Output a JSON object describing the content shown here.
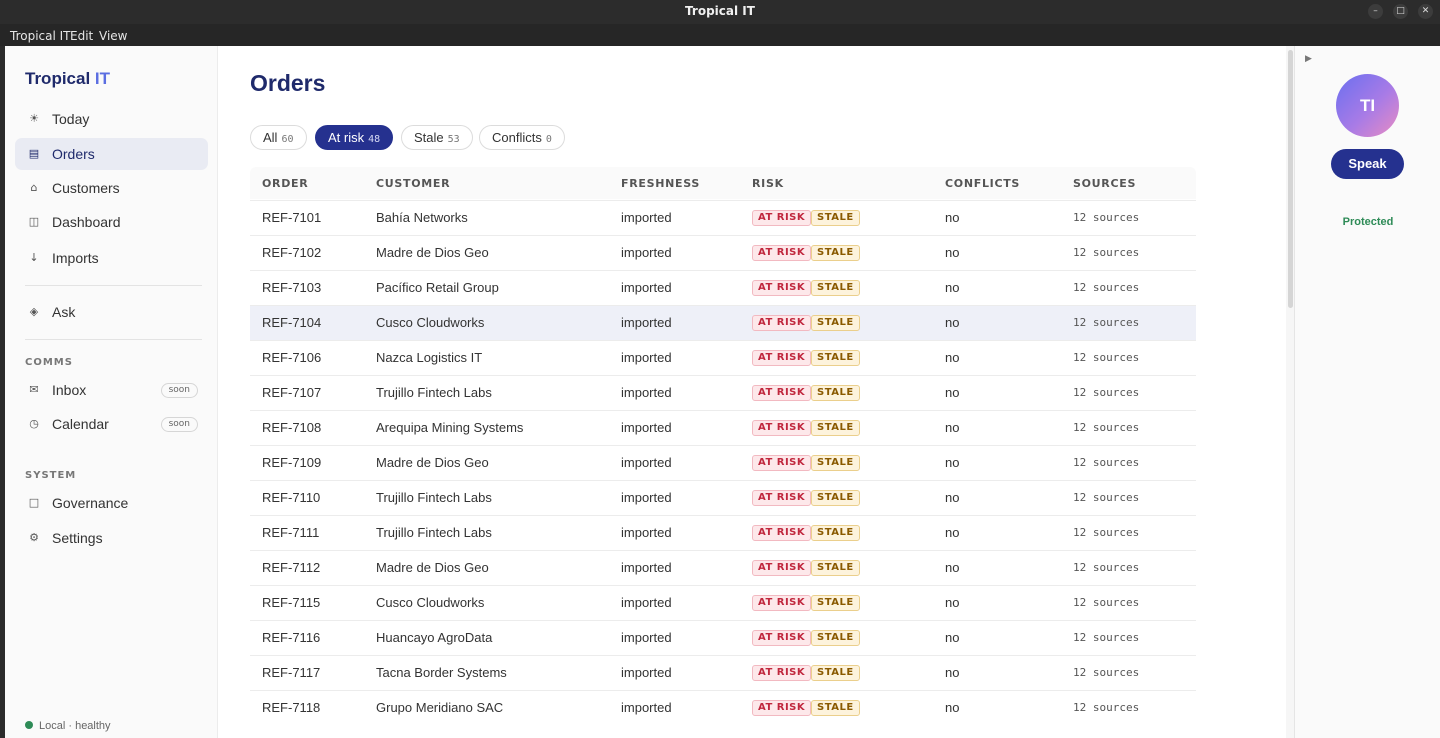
{
  "window": {
    "title": "Tropical IT"
  },
  "menu": [
    "Tropical IT",
    "Edit",
    "View"
  ],
  "brand": {
    "name": "Tropical",
    "accent": "IT"
  },
  "nav": {
    "today": "Today",
    "orders": "Orders",
    "customers": "Customers",
    "dashboard": "Dashboard",
    "imports": "Imports",
    "ask": "Ask",
    "comms_label": "COMMS",
    "inbox": "Inbox",
    "calendar": "Calendar",
    "soon": "soon",
    "system_label": "SYSTEM",
    "governance": "Governance",
    "settings": "Settings"
  },
  "status": {
    "text": "Local · healthy"
  },
  "page": {
    "title": "Orders"
  },
  "filters": [
    {
      "label": "All",
      "count": "60"
    },
    {
      "label": "At risk",
      "count": "48"
    },
    {
      "label": "Stale",
      "count": "53"
    },
    {
      "label": "Conflicts",
      "count": "0"
    }
  ],
  "table": {
    "headers": [
      "ORDER",
      "CUSTOMER",
      "FRESHNESS",
      "RISK",
      "CONFLICTS",
      "SOURCES"
    ],
    "risk_tag": "AT RISK",
    "stale_tag": "STALE",
    "rows": [
      {
        "order": "REF-7101",
        "customer": "Bahía Networks",
        "freshness": "imported",
        "conflicts": "no",
        "sources": "12 sources"
      },
      {
        "order": "REF-7102",
        "customer": "Madre de Dios Geo",
        "freshness": "imported",
        "conflicts": "no",
        "sources": "12 sources"
      },
      {
        "order": "REF-7103",
        "customer": "Pacífico Retail Group",
        "freshness": "imported",
        "conflicts": "no",
        "sources": "12 sources"
      },
      {
        "order": "REF-7104",
        "customer": "Cusco Cloudworks",
        "freshness": "imported",
        "conflicts": "no",
        "sources": "12 sources"
      },
      {
        "order": "REF-7106",
        "customer": "Nazca Logistics IT",
        "freshness": "imported",
        "conflicts": "no",
        "sources": "12 sources"
      },
      {
        "order": "REF-7107",
        "customer": "Trujillo Fintech Labs",
        "freshness": "imported",
        "conflicts": "no",
        "sources": "12 sources"
      },
      {
        "order": "REF-7108",
        "customer": "Arequipa Mining Systems",
        "freshness": "imported",
        "conflicts": "no",
        "sources": "12 sources"
      },
      {
        "order": "REF-7109",
        "customer": "Madre de Dios Geo",
        "freshness": "imported",
        "conflicts": "no",
        "sources": "12 sources"
      },
      {
        "order": "REF-7110",
        "customer": "Trujillo Fintech Labs",
        "freshness": "imported",
        "conflicts": "no",
        "sources": "12 sources"
      },
      {
        "order": "REF-7111",
        "customer": "Trujillo Fintech Labs",
        "freshness": "imported",
        "conflicts": "no",
        "sources": "12 sources"
      },
      {
        "order": "REF-7112",
        "customer": "Madre de Dios Geo",
        "freshness": "imported",
        "conflicts": "no",
        "sources": "12 sources"
      },
      {
        "order": "REF-7115",
        "customer": "Cusco Cloudworks",
        "freshness": "imported",
        "conflicts": "no",
        "sources": "12 sources"
      },
      {
        "order": "REF-7116",
        "customer": "Huancayo AgroData",
        "freshness": "imported",
        "conflicts": "no",
        "sources": "12 sources"
      },
      {
        "order": "REF-7117",
        "customer": "Tacna Border Systems",
        "freshness": "imported",
        "conflicts": "no",
        "sources": "12 sources"
      },
      {
        "order": "REF-7118",
        "customer": "Grupo Meridiano SAC",
        "freshness": "imported",
        "conflicts": "no",
        "sources": "12 sources"
      }
    ]
  },
  "assistant": {
    "initials": "TI",
    "speak": "Speak",
    "status": "Protected"
  },
  "colors": {
    "primary": "#25318f",
    "brand": "#1f2a6b",
    "accent": "#5b6ee1",
    "risk": "#c0283e",
    "stale": "#8a5a00",
    "ok": "#2e8b57"
  }
}
